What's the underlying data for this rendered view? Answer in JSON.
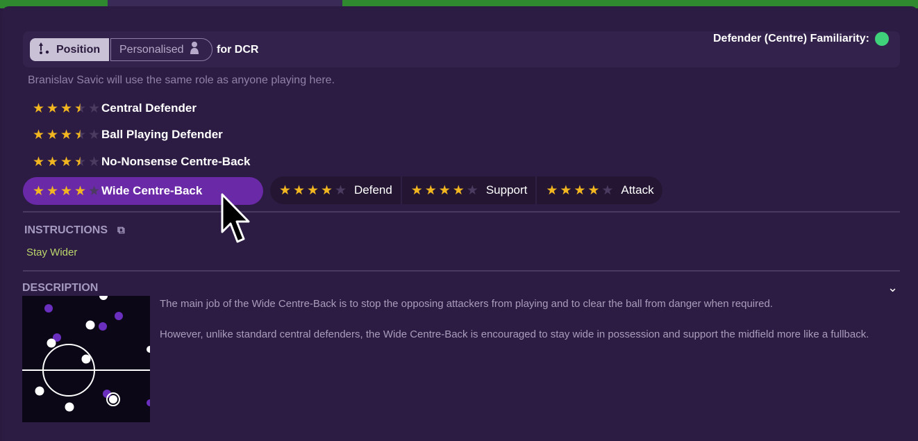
{
  "toggle": {
    "position_label": "Position",
    "personalised_label": "Personalised",
    "for_label": "for DCR"
  },
  "familiarity": {
    "label": "Defender (Centre) Familiarity:",
    "color": "#3fd27a"
  },
  "note": "Branislav Savic will use the same role as anyone playing here.",
  "roles": [
    {
      "name": "Central Defender",
      "rating": 3.5,
      "selected": false
    },
    {
      "name": "Ball Playing Defender",
      "rating": 3.5,
      "selected": false
    },
    {
      "name": "No-Nonsense Centre-Back",
      "rating": 3.5,
      "selected": false
    },
    {
      "name": "Wide Centre-Back",
      "rating": 4,
      "selected": true
    }
  ],
  "duties": [
    {
      "name": "Defend",
      "rating": 4
    },
    {
      "name": "Support",
      "rating": 4
    },
    {
      "name": "Attack",
      "rating": 4
    }
  ],
  "instructions": {
    "title": "INSTRUCTIONS",
    "items": [
      "Stay Wider"
    ]
  },
  "description": {
    "title": "DESCRIPTION",
    "paragraphs": [
      "The main job of the Wide Centre-Back is to stop the opposing attackers from playing and to clear the ball from danger when required.",
      "However, unlike standard central defenders, the Wide Centre-Back is encouraged to stay wide in possession and support the midfield more like a fullback."
    ]
  },
  "colors": {
    "accent_selected": "#6a2aa8",
    "star_on": "#f2b620",
    "instruction_text": "#bcd86c"
  }
}
